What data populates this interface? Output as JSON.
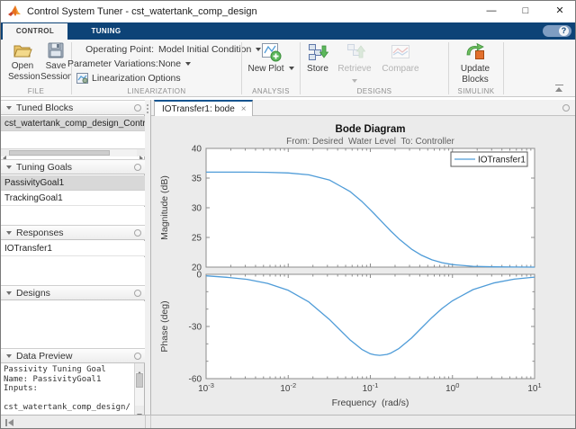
{
  "window": {
    "title": "Control System Tuner - cst_watertank_comp_design",
    "controls": {
      "minimize": "—",
      "maximize": "□",
      "close": "✕"
    }
  },
  "tabstrip": {
    "control_system": "CONTROL SYSTEM",
    "tuning": "TUNING",
    "help": "?"
  },
  "ribbon": {
    "file": {
      "section": "FILE",
      "open": "Open Session",
      "save": "Save Session"
    },
    "linearization": {
      "section": "LINEARIZATION",
      "op_label": "Operating Point:",
      "op_value": "Model Initial Condition",
      "pv_label": "Parameter Variations:",
      "pv_value": "None",
      "options": "Linearization Options"
    },
    "analysis": {
      "section": "ANALYSIS",
      "new_plot": "New Plot"
    },
    "designs": {
      "section": "DESIGNS",
      "store": "Store",
      "retrieve": "Retrieve",
      "compare": "Compare"
    },
    "simulink": {
      "section": "SIMULINK",
      "update_blocks": "Update Blocks"
    }
  },
  "sidebar": {
    "tuned_blocks": {
      "title": "Tuned Blocks",
      "items": [
        {
          "label": "cst_watertank_comp_design_Controller"
        }
      ]
    },
    "tuning_goals": {
      "title": "Tuning Goals",
      "items": [
        {
          "label": "PassivityGoal1"
        },
        {
          "label": "TrackingGoal1"
        }
      ]
    },
    "responses": {
      "title": "Responses",
      "items": [
        {
          "label": "IOTransfer1"
        }
      ]
    },
    "designs": {
      "title": "Designs"
    },
    "data_preview": {
      "title": "Data Preview",
      "lines": [
        "Passivity Tuning Goal",
        "Name: PassivityGoal1",
        "Inputs:",
        "",
        "cst_watertank_comp_design/"
      ]
    }
  },
  "main": {
    "document_tab": "IOTransfer1: bode",
    "close": "×"
  },
  "chart_data": {
    "type": "line",
    "title": "Bode Diagram",
    "subtitle": "From: Desired  Water Level  To: Controller",
    "xlabel": "Frequency  (rad/s)",
    "xscale": "log",
    "xlim_exponents": [
      -3,
      1
    ],
    "x_tick_exponents": [
      -3,
      -2,
      -1,
      0,
      1
    ],
    "line_color": "#4f9cd8",
    "legend": {
      "position": "top-right",
      "entries": [
        "IOTransfer1"
      ]
    },
    "subplots": [
      {
        "ylabel": "Magnitude (dB)",
        "ylim": [
          20,
          40
        ],
        "yticks": [
          20,
          25,
          30,
          35,
          40
        ],
        "series": [
          {
            "name": "IOTransfer1",
            "x_exponents": [
              -3,
              -2.75,
              -2.5,
              -2.25,
              -2,
              -1.75,
              -1.5,
              -1.25,
              -1.1,
              -1,
              -0.95,
              -0.886,
              -0.8,
              -0.75,
              -0.65,
              -0.5,
              -0.375,
              -0.25,
              -0.125,
              0,
              0.25,
              0.5,
              0.75,
              1
            ],
            "values": [
              36.0,
              36.0,
              36.0,
              35.97,
              35.87,
              35.55,
              34.68,
              32.76,
              31.01,
              29.65,
              28.94,
              28.01,
              26.77,
              26.06,
              24.74,
              23.04,
              21.98,
              21.23,
              20.74,
              20.43,
              20.14,
              20.05,
              20.02,
              20.0
            ]
          }
        ]
      },
      {
        "ylabel": "Phase (deg)",
        "ylim": [
          -60,
          0
        ],
        "yticks": [
          -60,
          -30,
          0
        ],
        "minor_ytick_step": 10,
        "series": [
          {
            "name": "IOTransfer1",
            "x_exponents": [
              -3,
              -2.75,
              -2.5,
              -2.25,
              -2,
              -1.75,
              -1.5,
              -1.25,
              -1.1,
              -1,
              -0.95,
              -0.886,
              -0.8,
              -0.75,
              -0.65,
              -0.5,
              -0.375,
              -0.25,
              -0.125,
              0,
              0.25,
              0.5,
              0.75,
              1
            ],
            "values": [
              -0.9,
              -1.7,
              -2.9,
              -5.2,
              -9.2,
              -15.9,
              -25.9,
              -37.6,
              -43.3,
              -45.7,
              -46.3,
              -46.6,
              -46.1,
              -45.3,
              -42.6,
              -36.7,
              -30.8,
              -24.9,
              -19.6,
              -15.2,
              -8.8,
              -5.0,
              -2.8,
              -1.6
            ]
          }
        ]
      }
    ]
  }
}
